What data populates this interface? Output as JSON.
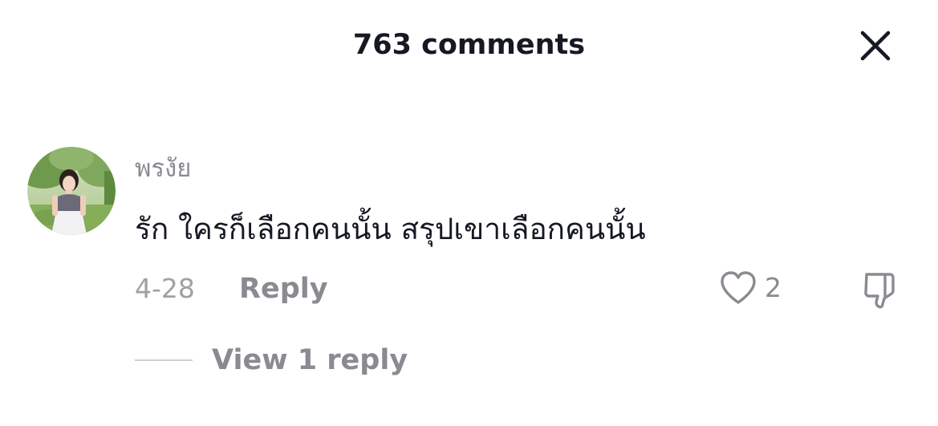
{
  "header": {
    "title": "763 comments",
    "close_icon": "close-icon"
  },
  "comment": {
    "avatar_icon": "user-avatar-photo",
    "username": "พรงัย",
    "text": "รัก ใครก็เลือกคนนั้น สรุปเขาเลือกคนนั้น",
    "date": "4-28",
    "reply_label": "Reply",
    "like_icon": "heart-outline-icon",
    "like_count": "2",
    "dislike_icon": "thumbs-down-outline-icon",
    "view_replies_label": "View 1 reply"
  }
}
